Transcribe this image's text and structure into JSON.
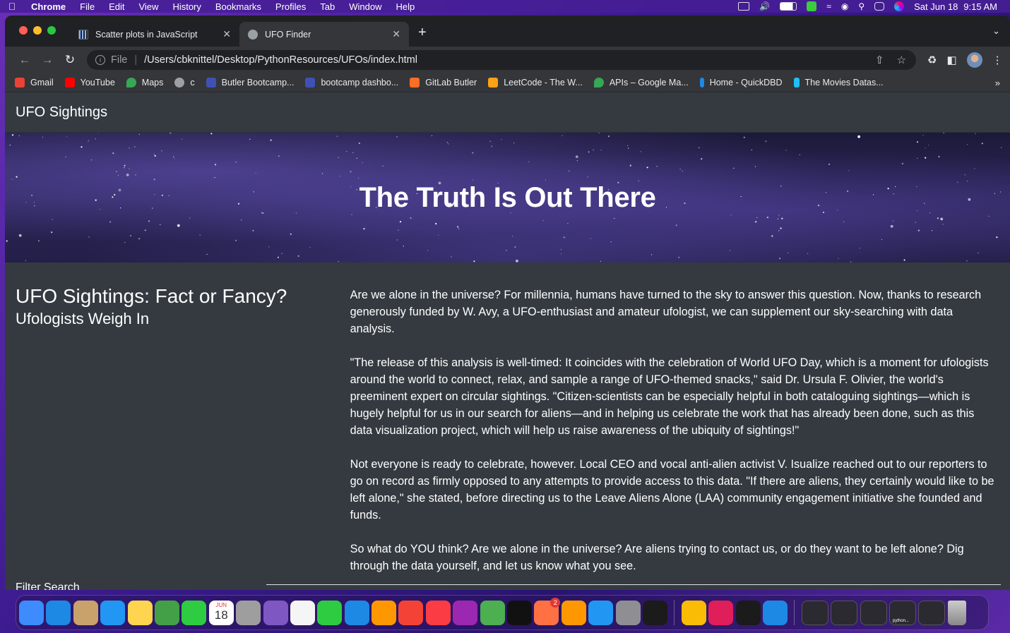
{
  "menubar": {
    "items": [
      "Chrome",
      "File",
      "Edit",
      "View",
      "History",
      "Bookmarks",
      "Profiles",
      "Tab",
      "Window",
      "Help"
    ],
    "date": "Sat Jun 18",
    "time": "9:15 AM",
    "status_icons": [
      "display-icon",
      "volume-icon",
      "battery-icon",
      "app-status-icon",
      "wifi-icon",
      "user-icon",
      "spotlight-icon",
      "control-center-icon",
      "siri-icon"
    ]
  },
  "tabs": [
    {
      "title": "Scatter plots in JavaScript",
      "active": false
    },
    {
      "title": "UFO Finder",
      "active": true
    }
  ],
  "toolbar": {
    "scheme": "File",
    "url": "/Users/cbknittel/Desktop/PythonResources/UFOs/index.html"
  },
  "bookmarks": [
    {
      "label": "Gmail",
      "color": "#ea4335"
    },
    {
      "label": "YouTube",
      "color": "#ff0000"
    },
    {
      "label": "Maps",
      "color": "#34a853"
    },
    {
      "label": "c",
      "color": "#9aa0a6"
    },
    {
      "label": "Butler Bootcamp...",
      "color": "#3f51b5"
    },
    {
      "label": "bootcamp dashbo...",
      "color": "#3f51b5"
    },
    {
      "label": "GitLab Butler",
      "color": "#fc6d26"
    },
    {
      "label": "LeetCode - The W...",
      "color": "#ffa116"
    },
    {
      "label": "APIs – Google Ma...",
      "color": "#34a853"
    },
    {
      "label": "Home - QuickDBD",
      "color": "#1e88e5"
    },
    {
      "label": "The Movies Datas...",
      "color": "#20beff"
    }
  ],
  "page": {
    "brand": "UFO Sightings",
    "hero_title": "The Truth Is Out There",
    "heading": "UFO Sightings: Fact or Fancy?",
    "subheading": "Ufologists Weigh In",
    "paragraphs": [
      "Are we alone in the universe? For millennia, humans have turned to the sky to answer this question. Now, thanks to research generously funded by W. Avy, a UFO-enthusiast and amateur ufologist, we can supplement our sky-searching with data analysis.",
      "\"The release of this analysis is well-timed: It coincides with the celebration of World UFO Day, which is a moment for ufologists around the world to connect, relax, and sample a range of UFO-themed snacks,\" said Dr. Ursula F. Olivier, the world's preeminent expert on circular sightings. \"Citizen-scientists can be especially helpful in both cataloguing sightings—which is hugely helpful for us in our search for aliens—and in helping us celebrate the work that has already been done, such as this data visualization project, which will help us raise awareness of the ubiquity of sightings!\"",
      "Not everyone is ready to celebrate, however. Local CEO and vocal anti-alien activist V. Isualize reached out to our reporters to go on record as firmly opposed to any attempts to provide access to this data. \"If there are aliens, they certainly would like to be left alone,\" she stated, before directing us to the Leave Aliens Alone (LAA) community engagement initiative she founded and funds.",
      "So what do YOU think? Are we alone in the universe? Are aliens trying to contact us, or do they want to be left alone? Dig through the data yourself, and let us know what you see."
    ],
    "filter_label": "Filter Search"
  },
  "dock": {
    "apps": [
      {
        "name": "finder",
        "color": "#3d8bfd"
      },
      {
        "name": "safari",
        "color": "#1e88e5"
      },
      {
        "name": "contacts",
        "color": "#c8a26a"
      },
      {
        "name": "mail",
        "color": "#2196f3"
      },
      {
        "name": "notes",
        "color": "#ffd54f"
      },
      {
        "name": "maps",
        "color": "#43a047"
      },
      {
        "name": "facetime",
        "color": "#2ecc40"
      },
      {
        "name": "calendar",
        "color": "#ffffff"
      },
      {
        "name": "launchpad",
        "color": "#9e9e9e"
      },
      {
        "name": "siri",
        "color": "#7e57c2"
      },
      {
        "name": "reminders",
        "color": "#f5f5f5"
      },
      {
        "name": "numbers",
        "color": "#2ecc40"
      },
      {
        "name": "keynote",
        "color": "#1e88e5"
      },
      {
        "name": "pages",
        "color": "#ff9800"
      },
      {
        "name": "news",
        "color": "#f44336"
      },
      {
        "name": "music",
        "color": "#fc3c44"
      },
      {
        "name": "podcasts",
        "color": "#9c27b0"
      },
      {
        "name": "messages",
        "color": "#4caf50"
      },
      {
        "name": "tv",
        "color": "#111111"
      },
      {
        "name": "photos",
        "color": "#ff7043",
        "badge": "2"
      },
      {
        "name": "books",
        "color": "#ff9800"
      },
      {
        "name": "app-store",
        "color": "#2196f3"
      },
      {
        "name": "system-preferences",
        "color": "#8e8e93"
      },
      {
        "name": "terminal",
        "color": "#1b1b1b"
      },
      {
        "name": "chrome",
        "color": "#fbbc05"
      },
      {
        "name": "slack",
        "color": "#e01e5a"
      },
      {
        "name": "activity",
        "color": "#1b1b1b"
      },
      {
        "name": "vscode",
        "color": "#1e88e5"
      }
    ],
    "calendar_month": "JUN",
    "calendar_day": "18",
    "recent_label": "python..."
  }
}
